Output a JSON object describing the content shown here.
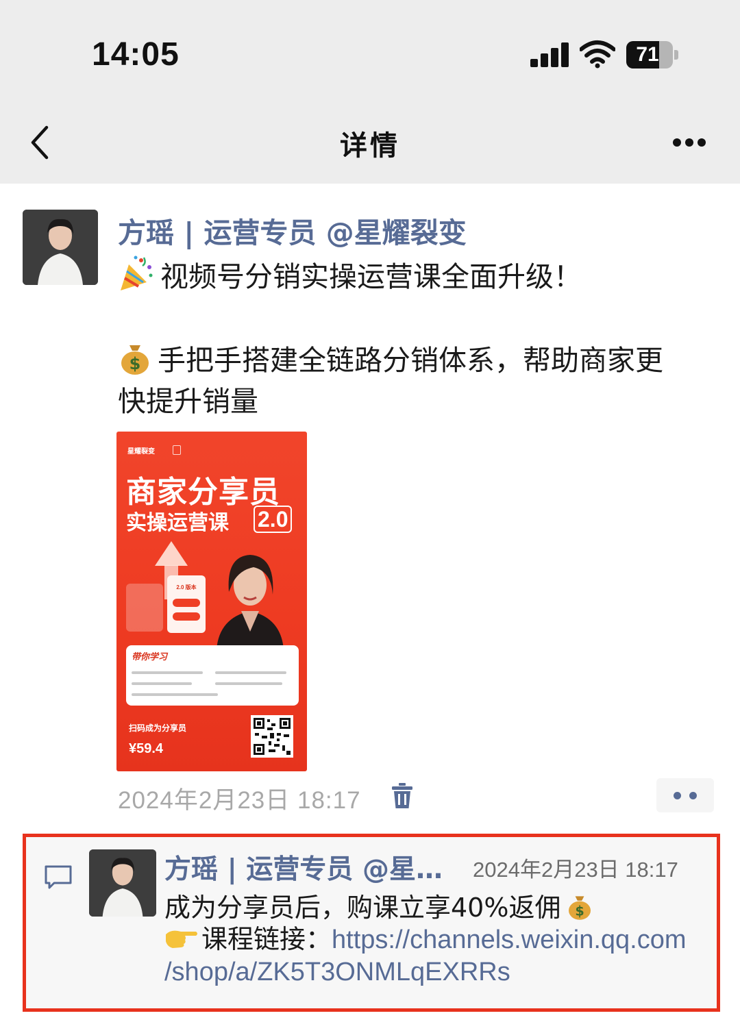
{
  "status_bar": {
    "time": "14:05",
    "battery": "71",
    "battery_level": 0.71
  },
  "nav": {
    "title": "详情"
  },
  "post": {
    "author": "方瑶 | 运营专员 @星耀裂变",
    "line1": "视频号分销实操运营课全面升级！",
    "line2": "手把手搭建全链路分销体系，帮助商家更",
    "line3": "快提升销量",
    "date": "2024年2月23日 18:17",
    "poster": {
      "brand": "星耀裂变",
      "title": "商家分享员",
      "subtitle": "实操运营课",
      "version": "2.0",
      "card_title": "2.0 版本",
      "panel_heading": "带你学习",
      "scan_text": "扫码成为分享员",
      "price": "¥59.4"
    }
  },
  "comment": {
    "author": "方瑶 | 运营专员 @星耀...",
    "date": "2024年2月23日 18:17",
    "line1": "成为分享员后，购课立享40%返佣",
    "line2_label": "课程链接：",
    "line2_link": "https://channels.weixin.qq.com",
    "line3_link": "/shop/a/ZK5T3ONMLqEXRRs"
  },
  "icons": {
    "back": "chevron-left-icon",
    "more": "more-dots-icon",
    "delete": "trash-icon",
    "comment": "comment-bubble-icon",
    "party": "party-popper-emoji",
    "money": "money-bag-emoji",
    "pointer": "pointing-hand-emoji"
  },
  "colors": {
    "link": "#576b95",
    "highlight_border": "#e8321d",
    "poster_red": "#ee3b22"
  }
}
